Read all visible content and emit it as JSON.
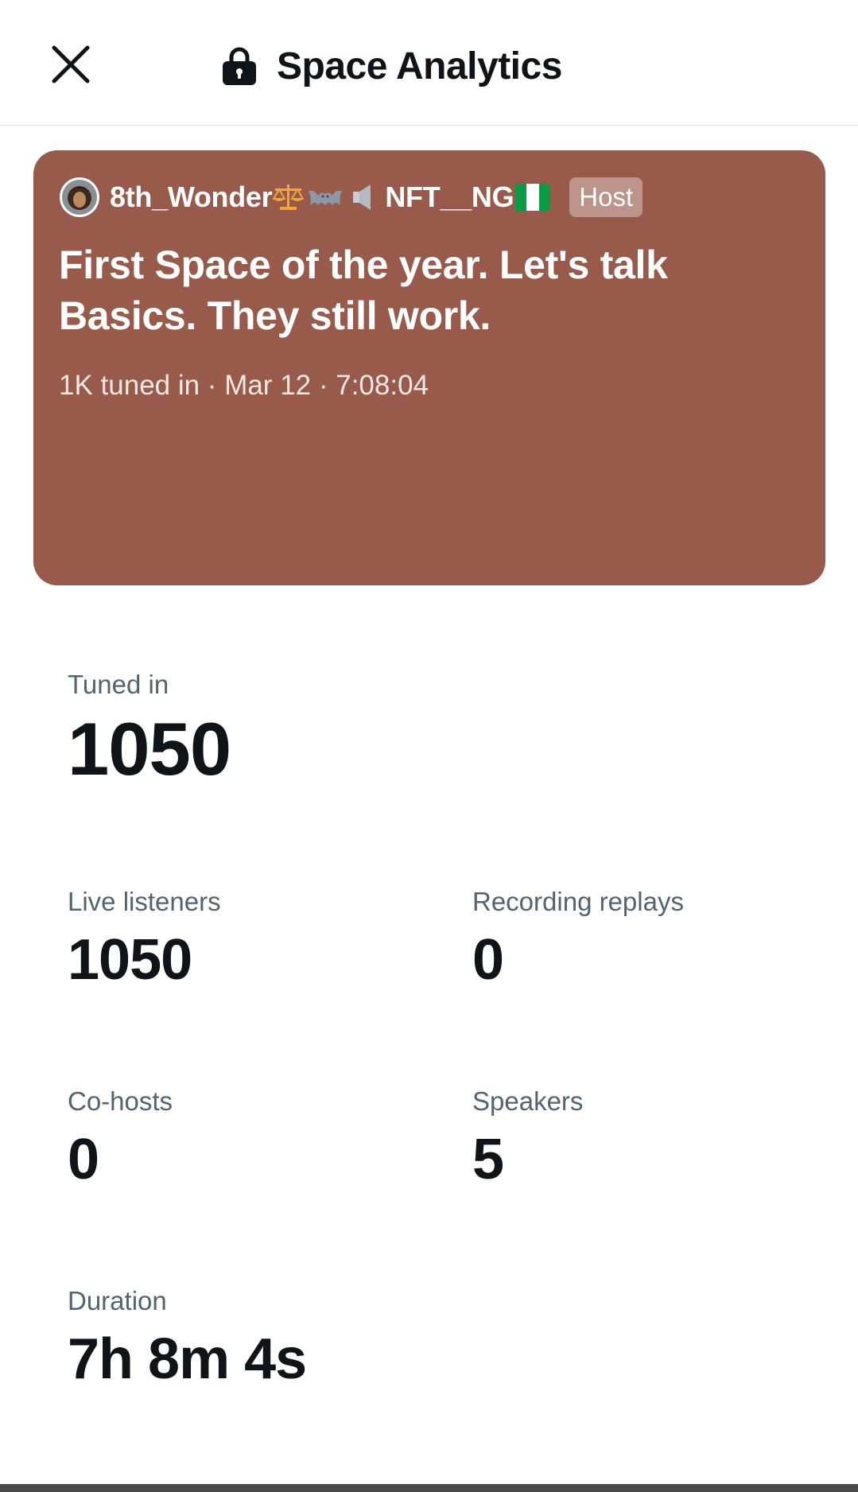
{
  "header": {
    "title": "Space Analytics",
    "close_icon": "close-icon",
    "lock_icon": "lock-icon"
  },
  "space": {
    "host_name": "8th_Wonder",
    "host_name_suffix": "NFT__NG",
    "host_emojis": [
      "scales-emoji",
      "bat-emoji",
      "speaker-emoji",
      "nigeria-flag-emoji"
    ],
    "host_badge": "Host",
    "title": "First Space of the year. Let's talk Basics. They still work.",
    "meta": "1K tuned in · Mar 12 · 7:08:04",
    "card_color": "#985b4b"
  },
  "stats": {
    "tuned_in": {
      "label": "Tuned in",
      "value": "1050"
    },
    "live_listeners": {
      "label": "Live listeners",
      "value": "1050"
    },
    "recording_replays": {
      "label": "Recording replays",
      "value": "0"
    },
    "co_hosts": {
      "label": "Co-hosts",
      "value": "0"
    },
    "speakers": {
      "label": "Speakers",
      "value": "5"
    },
    "duration": {
      "label": "Duration",
      "value": "7h 8m 4s"
    }
  }
}
